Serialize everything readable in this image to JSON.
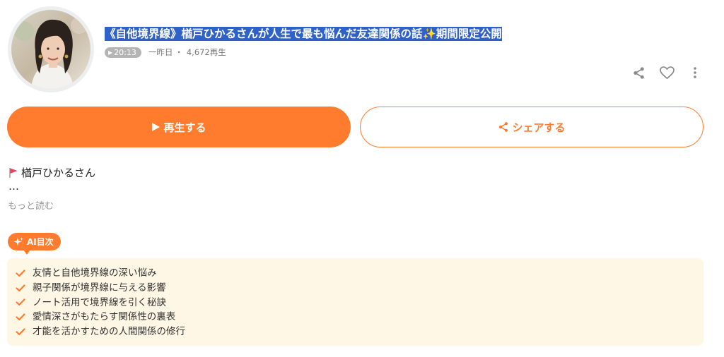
{
  "episode": {
    "title_prefix": "《自他境界線》楢戸ひかるさんが人生で最も悩んだ友達関係の話",
    "title_emoji": "✨",
    "title_suffix": "期間限定公開",
    "duration": "20:13",
    "date": "一昨日",
    "separator": "・",
    "plays": "4,672再生"
  },
  "icons": [
    "share-icon",
    "heart-icon",
    "more-icon",
    "play-icon",
    "flag-icon",
    "sparkle-icon",
    "check-icon"
  ],
  "buttons": {
    "play_label": "再生する",
    "share_label": "シェアする"
  },
  "description": {
    "host": "楢戸ひかるさん",
    "ellipsis": "…",
    "more": "もっと読む"
  },
  "ai_toc": {
    "badge": "AI目次",
    "items": [
      "友情と自他境界線の深い悩み",
      "親子関係が境界線に与える影響",
      "ノート活用で境界線を引く秘訣",
      "愛情深さがもたらす関係性の裏表",
      "才能を活かすための人間関係の修行"
    ]
  },
  "colors": {
    "accent": "#ff7b2e",
    "toc_bg": "#fff7e6",
    "title_highlight": "#2f62c9",
    "flag": "#e8455c"
  }
}
